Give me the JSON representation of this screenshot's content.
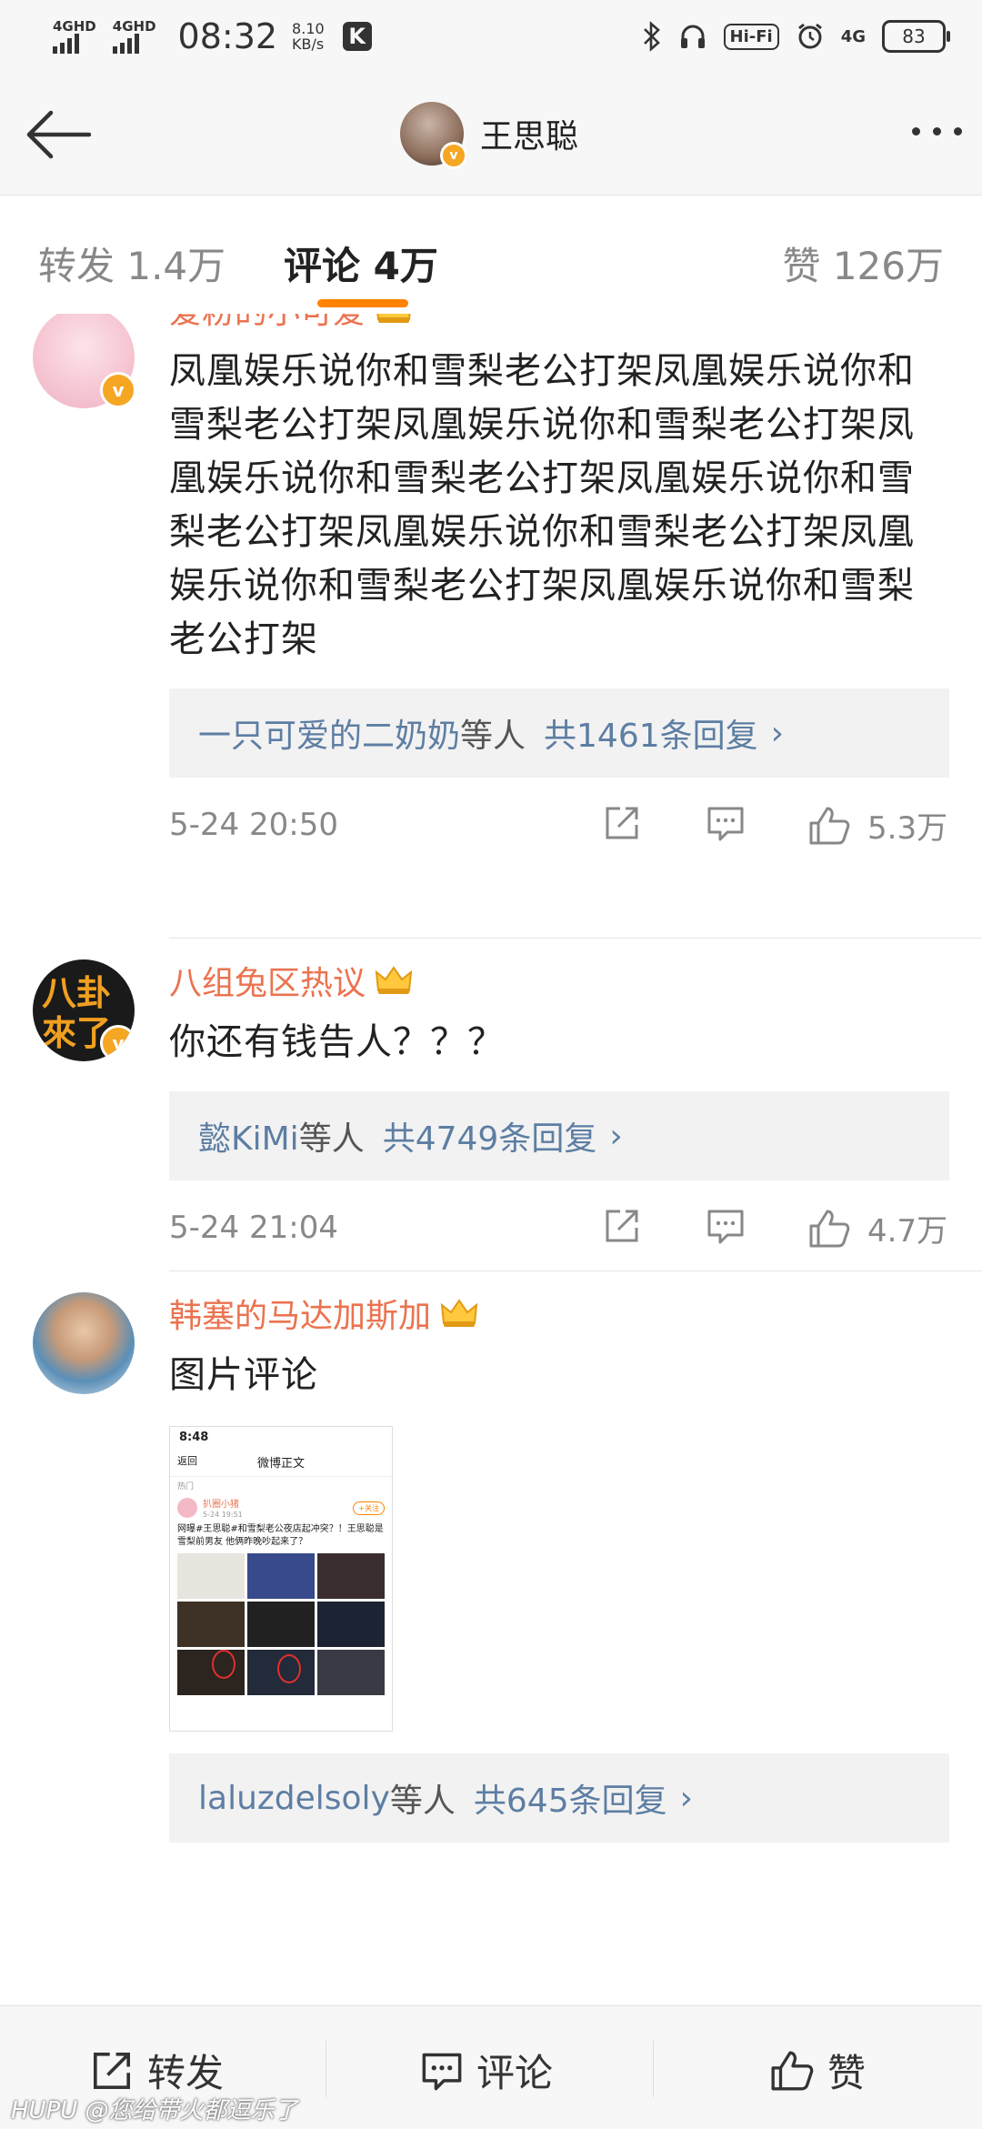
{
  "status_bar": {
    "signal1": "4GHD",
    "signal2": "4GHD",
    "time": "08:32",
    "speed_value": "8.10",
    "speed_unit": "KB/s",
    "app_badge": "K",
    "hifi": "Hi-Fi",
    "network": "4G",
    "battery": "83"
  },
  "nav": {
    "title": "王思聪"
  },
  "tabs": {
    "repost": "转发 1.4万",
    "comment": "评论 4万",
    "like": "赞 126万",
    "active_color": "#ff8200"
  },
  "comments": [
    {
      "user": "爱粉的小可爱",
      "text": "凤凰娱乐说你和雪梨老公打架凤凰娱乐说你和雪梨老公打架凤凰娱乐说你和雪梨老公打架凤凰娱乐说你和雪梨老公打架凤凰娱乐说你和雪梨老公打架凤凰娱乐说你和雪梨老公打架凤凰娱乐说你和雪梨老公打架凤凰娱乐说你和雪梨老公打架",
      "reply_user": "一只可爱的二奶奶",
      "reply_etc": "等人",
      "reply_count": "共1461条回复",
      "time": "5-24 20:50",
      "likes": "5.3万"
    },
    {
      "user": "八组兔区热议",
      "text": "你还有钱告人？？？",
      "reply_user": "懿KiMi",
      "reply_etc": "等人",
      "reply_count": "共4749条回复",
      "time": "5-24 21:04",
      "likes": "4.7万"
    },
    {
      "user": "韩塞的马达加斯加",
      "text": "图片评论",
      "reply_user": "laluzdelsoly",
      "reply_etc": "等人",
      "reply_count": "共645条回复"
    }
  ],
  "embedded_image": {
    "time": "8:48",
    "back": "返回",
    "header": "微博正文",
    "hot": "热门",
    "user": "扒圈小猪",
    "date": "5-24 19:51",
    "follow": "+关注",
    "text": "网曝#王思聪#和雪梨老公夜店起冲突？！王思聪是雪梨前男友 他俩昨晚吵起来了？"
  },
  "bottom_bar": {
    "repost": "转发",
    "comment": "评论",
    "like": "赞"
  },
  "watermark": "HUPU @您给带火都逗乐了",
  "colors": {
    "username": "#eb7350",
    "link": "#5d7ea3",
    "accent": "#ff8200",
    "verified": "#f5a623"
  }
}
